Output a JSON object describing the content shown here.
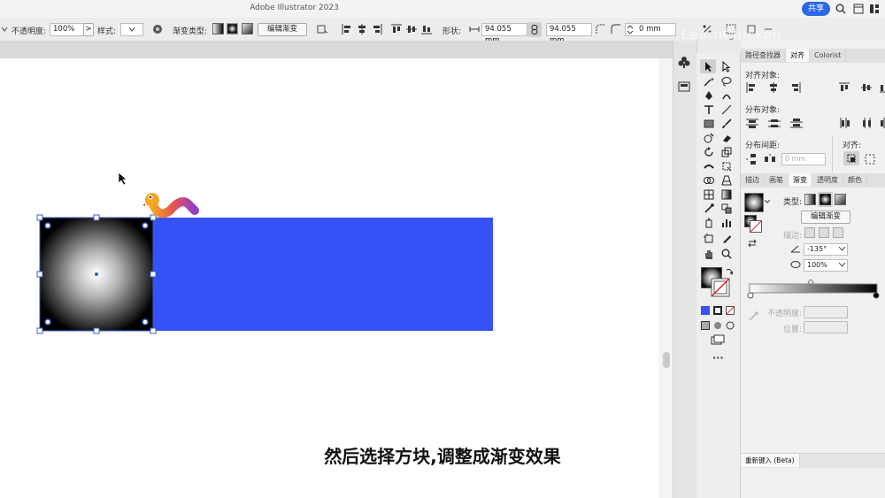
{
  "app": {
    "title": "Adobe Illustrator 2023",
    "share_label": "共享"
  },
  "control_bar": {
    "opacity_label": "不透明度:",
    "opacity_value": "100%",
    "opacity_arrow": ">",
    "style_label": "样式:",
    "gradient_type_label": "渐变类型:",
    "edit_gradient_label": "编辑渐变",
    "shape_label": "形状:",
    "width_value": "94.055 mm",
    "height_value": "94.055 mm",
    "corner_value": "0 mm"
  },
  "canvas": {
    "caption": "然后选择方块,调整成渐变效果",
    "watermark": "LearnChicken"
  },
  "panels": {
    "top_tabs": [
      "路径查找器",
      "对齐",
      "Colorist"
    ],
    "align_objects_label": "对齐对象:",
    "distribute_objects_label": "分布对象:",
    "distribute_spacing_label": "分布间距:",
    "align_to_label": "对齐:",
    "spacing_value": "0 mm",
    "gradient_tabs": [
      "描边",
      "画笔",
      "渐变",
      "透明度",
      "颜色"
    ],
    "type_label": "类型:",
    "edit_gradient_label": "编辑渐变",
    "stroke_label": "描边:",
    "angle_value": "-135°",
    "aspect_value": "100%",
    "opacity_label": "不透明度:",
    "position_label": "位置:",
    "reset_label": "重新键入 (Beta)"
  },
  "colors": {
    "blue_rect": "#3452f5",
    "accent": "#2b68e8"
  }
}
